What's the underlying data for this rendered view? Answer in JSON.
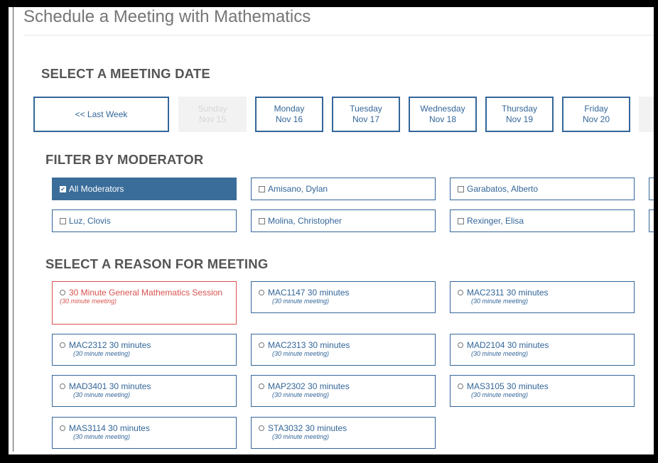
{
  "title": "Schedule a Meeting with Mathematics",
  "sections": {
    "date": "SELECT A MEETING DATE",
    "moderator": "FILTER BY MODERATOR",
    "reason": "SELECT A REASON FOR MEETING"
  },
  "dates": {
    "last_week": "<< Last Week",
    "days": [
      {
        "day": "Sunday",
        "date": "Nov 15",
        "disabled": true
      },
      {
        "day": "Monday",
        "date": "Nov 16",
        "disabled": false
      },
      {
        "day": "Tuesday",
        "date": "Nov 17",
        "disabled": false
      },
      {
        "day": "Wednesday",
        "date": "Nov 18",
        "disabled": false
      },
      {
        "day": "Thursday",
        "date": "Nov 19",
        "disabled": false
      },
      {
        "day": "Friday",
        "date": "Nov 20",
        "disabled": false
      }
    ]
  },
  "moderators": [
    {
      "label": "All Moderators",
      "checked": true
    },
    {
      "label": "Amisano, Dylan",
      "checked": false
    },
    {
      "label": "Garabatos, Alberto",
      "checked": false
    },
    {
      "label": "Luz, Clovis",
      "checked": false
    },
    {
      "label": "Molina, Christopher",
      "checked": false
    },
    {
      "label": "Rexinger, Elisa",
      "checked": false
    }
  ],
  "reasons": [
    {
      "label": "30 Minute General Mathematics Session",
      "sub": "(30 minute meeting)",
      "selected": true
    },
    {
      "label": "MAC1147 30 minutes",
      "sub": "(30 minute meeting)",
      "selected": false
    },
    {
      "label": "MAC2311 30 minutes",
      "sub": "(30 minute meeting)",
      "selected": false
    },
    {
      "label": "MAC2312 30 minutes",
      "sub": "(30 minute meeting)",
      "selected": false
    },
    {
      "label": "MAC2313 30 minutes",
      "sub": "(30 minute meeting)",
      "selected": false
    },
    {
      "label": "MAD2104 30 minutes",
      "sub": "(30 minute meeting)",
      "selected": false
    },
    {
      "label": "MAD3401 30 minutes",
      "sub": "(30 minute meeting)",
      "selected": false
    },
    {
      "label": "MAP2302 30 minutes",
      "sub": "(30 minute meeting)",
      "selected": false
    },
    {
      "label": "MAS3105 30 minutes",
      "sub": "(30 minute meeting)",
      "selected": false
    },
    {
      "label": "MAS3114 30 minutes",
      "sub": "(30 minute meeting)",
      "selected": false
    },
    {
      "label": "STA3032 30 minutes",
      "sub": "(30 minute meeting)",
      "selected": false
    }
  ],
  "colors": {
    "primary": "#336699",
    "active": "#3a6d9a",
    "selected": "#d9534f",
    "disabled_bg": "#f2f2f2",
    "heading": "#555555"
  }
}
